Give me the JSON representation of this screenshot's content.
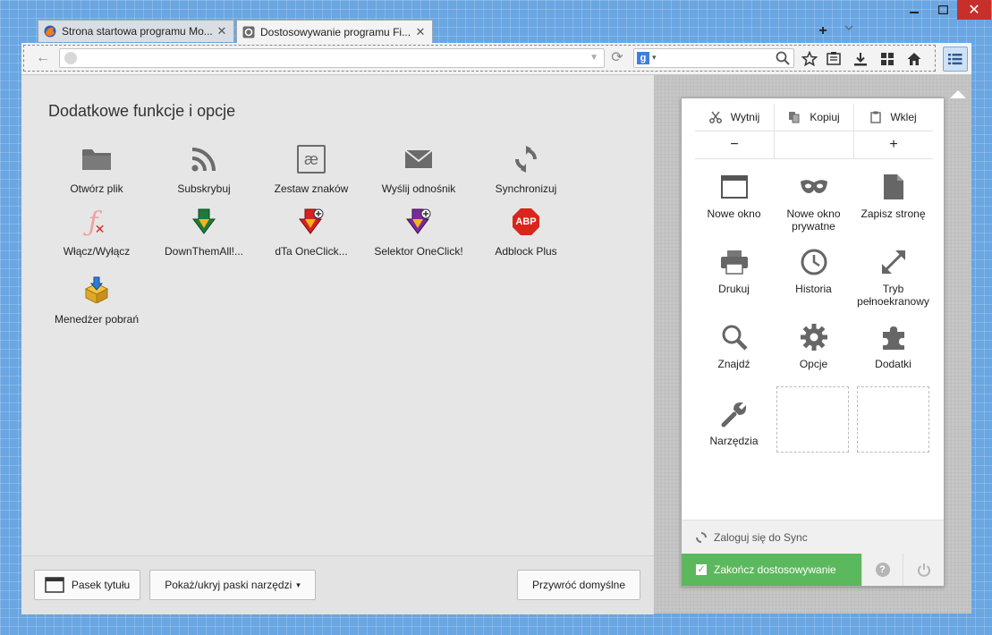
{
  "window": {
    "min_glyph": "—",
    "max_glyph": "☐",
    "close_glyph": "✕"
  },
  "tabs": [
    {
      "label": "Strona startowa programu Mo...",
      "close": "✕"
    },
    {
      "label": "Dostosowywanie programu Fi...",
      "close": "✕"
    }
  ],
  "tabstrip": {
    "newtab_glyph": "+",
    "tablist_glyph": "⌄"
  },
  "navbar": {
    "back_glyph": "←",
    "url_value": "",
    "url_placeholder": "",
    "reload_glyph": "⟳",
    "search_engine": "g",
    "search_value": ""
  },
  "palette": {
    "title": "Dodatkowe funkcje i opcje",
    "items": [
      {
        "label": "Otwórz plik",
        "icon": "folder-icon"
      },
      {
        "label": "Subskrybuj",
        "icon": "rss-icon"
      },
      {
        "label": "Zestaw znaków",
        "icon": "charset-icon",
        "glyph": "æ"
      },
      {
        "label": "Wyślij odnośnik",
        "icon": "mail-icon"
      },
      {
        "label": "Synchronizuj",
        "icon": "sync-icon"
      },
      {
        "label": "Włącz/Wyłącz",
        "icon": "flash-disable-icon",
        "glyph": "ƒ"
      },
      {
        "label": "DownThemAll!...",
        "icon": "downthemall-icon"
      },
      {
        "label": "dTa OneClick...",
        "icon": "dta-oneclick-icon"
      },
      {
        "label": "Selektor OneClick!",
        "icon": "oneclick-selector-icon"
      },
      {
        "label": "Adblock Plus",
        "icon": "adblock-plus-icon",
        "glyph": "ABP"
      },
      {
        "label": "Menedżer pobrań",
        "icon": "download-manager-icon"
      }
    ]
  },
  "bottom": {
    "title_bar_label": "Pasek tytułu",
    "toolbars_label": "Pokaż/ukryj paski narzędzi",
    "toolbars_caret": "▾",
    "restore_label": "Przywróć domyślne"
  },
  "menu": {
    "edit": {
      "cut": "Wytnij",
      "copy": "Kopiuj",
      "paste": "Wklej"
    },
    "zoom": {
      "out": "−",
      "in": "+"
    },
    "items": [
      {
        "label": "Nowe okno",
        "icon": "new-window-icon"
      },
      {
        "label": "Nowe okno prywatne",
        "icon": "private-window-icon"
      },
      {
        "label": "Zapisz stronę",
        "icon": "save-page-icon"
      },
      {
        "label": "Drukuj",
        "icon": "print-icon"
      },
      {
        "label": "Historia",
        "icon": "history-icon"
      },
      {
        "label": "Tryb pełnoekranowy",
        "icon": "fullscreen-icon"
      },
      {
        "label": "Znajdź",
        "icon": "find-icon"
      },
      {
        "label": "Opcje",
        "icon": "options-icon"
      },
      {
        "label": "Dodatki",
        "icon": "addons-icon"
      },
      {
        "label": "Narzędzia",
        "icon": "tools-icon"
      }
    ],
    "sync_label": "Zaloguj się do Sync",
    "finish_label": "Zakończ dostosowywanie",
    "help_glyph": "?",
    "check_glyph": "✓"
  },
  "colors": {
    "accent_green": "#5cb85c",
    "desktop_blue": "#6aa6e2",
    "close_red": "#c7302a"
  }
}
